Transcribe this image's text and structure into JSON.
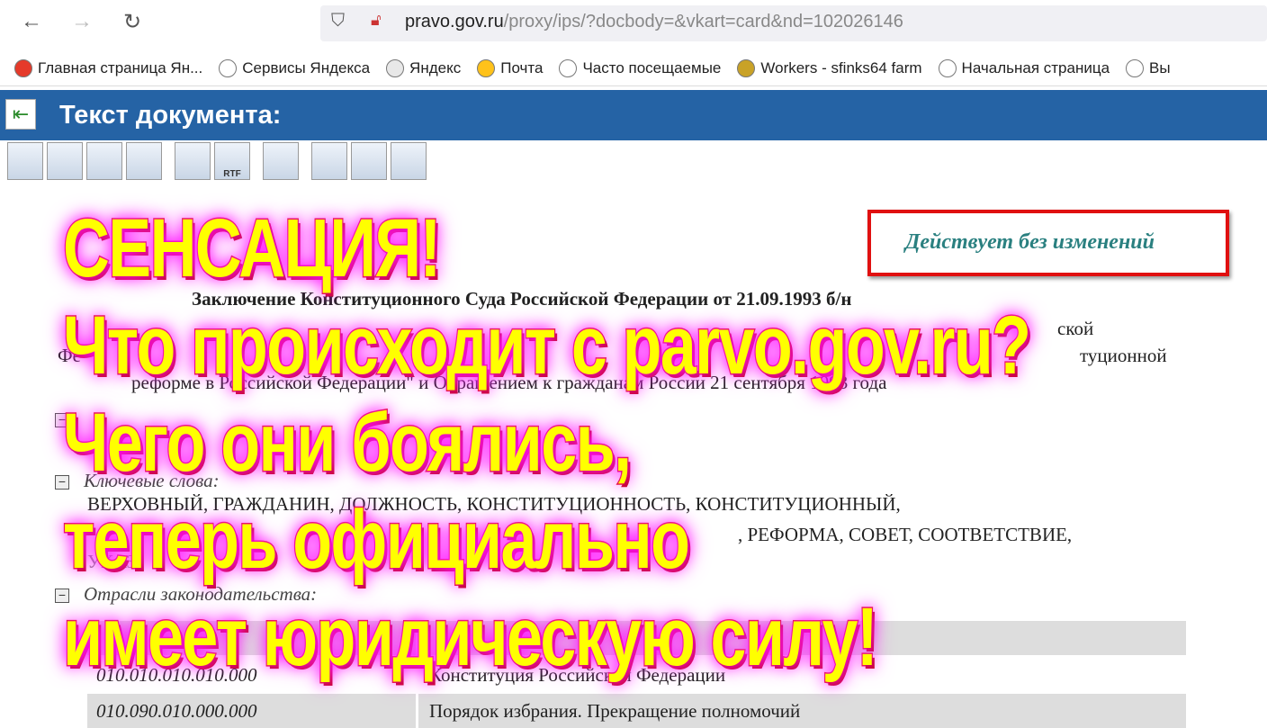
{
  "browser": {
    "url_domain": "pravo.gov.ru",
    "url_path": "/proxy/ips/?docbody=&vkart=card&nd=102026146",
    "bookmarks": [
      {
        "label": "Главная страница Ян...",
        "color": "#e53a2a"
      },
      {
        "label": "Сервисы Яндекса",
        "color": "#ffffff"
      },
      {
        "label": "Яндекс",
        "color": "#e8e8e8"
      },
      {
        "label": "Почта",
        "color": "#ffc21a"
      },
      {
        "label": "Часто посещаемые",
        "color": "#ffffff"
      },
      {
        "label": "Workers - sfinks64 farm",
        "color": "#c9a227"
      },
      {
        "label": "Начальная страница",
        "color": "#ffffff"
      },
      {
        "label": "Вы",
        "color": "#ffffff"
      }
    ]
  },
  "header": {
    "title": "Текст документа:"
  },
  "toolbar": {
    "rtf_label": "RTF"
  },
  "document": {
    "status": "Действует без изменений",
    "title": "Заключение Конституционного Суда Российской Федерации от 21.09.1993 б/н",
    "line1_end": "ской",
    "line2_start": "Фе",
    "line2_end": "туционной",
    "line3": "реформе в Российской Федерации\" и Обращением к гражданам России 21 сентября 1993 года",
    "keywords_label": "Ключевые слова:",
    "keywords_line1": "ВЕРХОВНЫЙ, ГРАЖДАНИН, ДОЛЖНОСТЬ, КОНСТИТУЦИОННОСТЬ, КОНСТИТУЦИОННЫЙ,",
    "keywords_line2": ", РЕФОРМА, СОВЕТ, СООТВЕТСТВИЕ,",
    "keywords_line3": "УКАЗ",
    "branches_label": "Отрасли законодательства:",
    "branches": [
      {
        "code": "010.010.010.010.000",
        "name": "Конституция Российской Федерации"
      },
      {
        "code": "010.090.010.000.000",
        "name": "Порядок избрания. Прекращение полномочий"
      }
    ]
  },
  "overlay": {
    "lines": [
      "СЕНСАЦИЯ!",
      "Что происходит с parvo.gov.ru?",
      "Чего они боялись,",
      "теперь официально",
      "имеет юридическую силу!"
    ]
  }
}
